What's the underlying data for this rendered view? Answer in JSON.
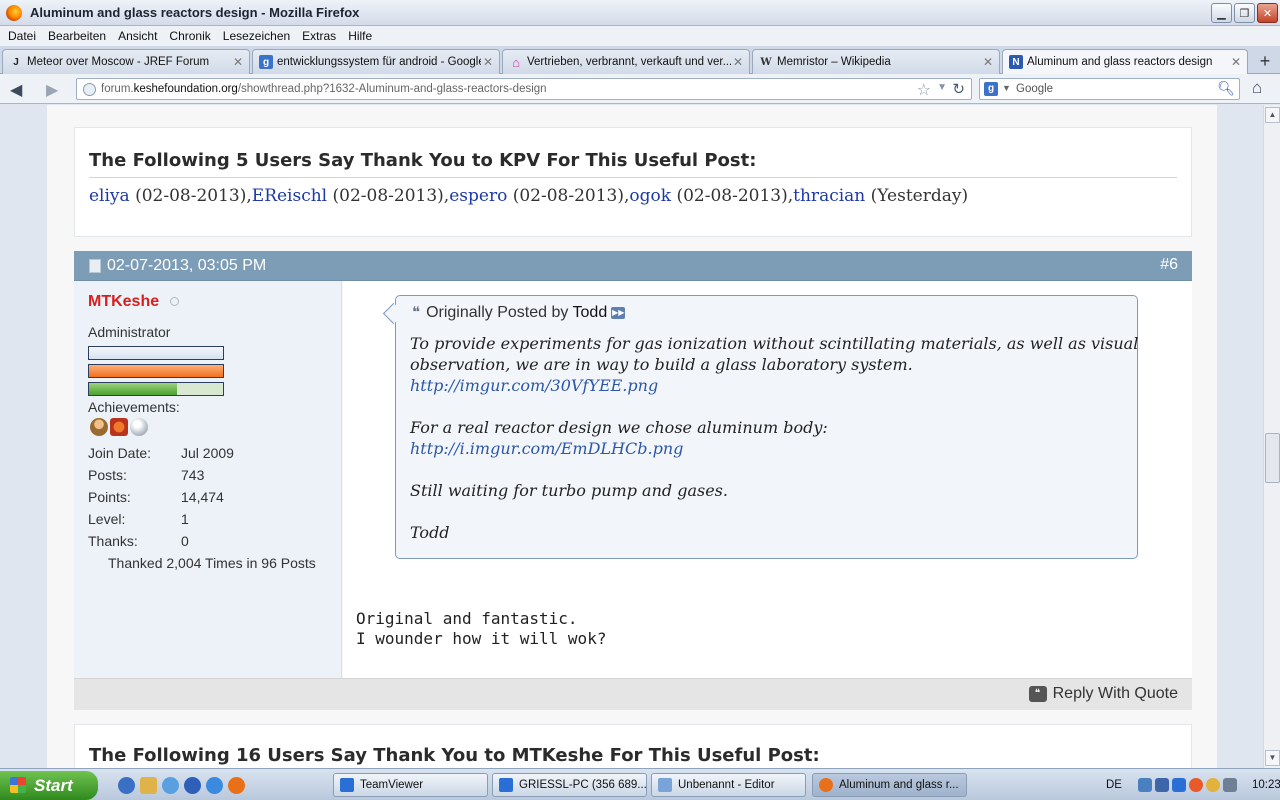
{
  "window": {
    "title": "Aluminum and glass reactors design - Mozilla Firefox"
  },
  "menu": [
    "Datei",
    "Bearbeiten",
    "Ansicht",
    "Chronik",
    "Lesezeichen",
    "Extras",
    "Hilfe"
  ],
  "tabs": [
    {
      "label": "Meteor over Moscow - JREF Forum",
      "icon": "jref-favicon",
      "icon_glyph": "J",
      "icon_color": "#222222"
    },
    {
      "label": "entwicklungssystem für android - Google-...",
      "icon": "google-favicon",
      "icon_glyph": "g",
      "icon_color": "#3a73c9"
    },
    {
      "label": "Vertrieben, verbrannt, verkauft und ver...",
      "icon": "house-favicon",
      "icon_glyph": "⌂",
      "icon_color": "#c93ca3"
    },
    {
      "label": "Memristor – Wikipedia",
      "icon": "wikipedia-favicon",
      "icon_glyph": "W",
      "icon_color": "#333333"
    },
    {
      "label": "Aluminum and glass reactors design",
      "icon": "keshe-favicon",
      "icon_glyph": "N",
      "icon_color": "#2a5bb0"
    }
  ],
  "nav": {
    "url_prefix": "forum.",
    "url_domain": "keshefoundation.org",
    "url_path": "/showthread.php?1632-Aluminum-and-glass-reactors-design",
    "search_engine": "g",
    "search_placeholder": "Google"
  },
  "thanks_top": {
    "title": "The Following 5 Users Say Thank You to KPV For This Useful Post:",
    "entries": [
      {
        "name": "eliya",
        "date": " (02-08-2013),"
      },
      {
        "name": "EReischl",
        "date": " (02-08-2013),"
      },
      {
        "name": "espero",
        "date": " (02-08-2013),"
      },
      {
        "name": "ogok",
        "date": " (02-08-2013),"
      },
      {
        "name": "thracian",
        "date": " (Yesterday)"
      }
    ]
  },
  "post": {
    "date": "02-07-2013, 03:05 PM",
    "number": "#6",
    "user": {
      "name": "MTKeshe",
      "role": "Administrator",
      "achievements_label": "Achievements:",
      "stats": [
        {
          "k": "Join Date:",
          "v": "Jul 2009"
        },
        {
          "k": "Posts:",
          "v": "743"
        },
        {
          "k": "Points:",
          "v": "14,474"
        },
        {
          "k": "Level:",
          "v": "1"
        },
        {
          "k": "Thanks:",
          "v": "0"
        }
      ],
      "thanked": "Thanked 2,004 Times in 96 Posts"
    },
    "quote": {
      "prefix": "Originally Posted by",
      "author": "Todd",
      "lines": [
        "To provide experiments for gas ionization without scintillating materials, as well as visual",
        "observation, we are in way to build a glass laboratory system.",
        "http://imgur.com/30VfYEE.png",
        "For a real reactor design we chose aluminum body:",
        "http://i.imgur.com/EmDLHCb.png",
        "Still waiting for turbo pump and gases.",
        "Todd"
      ]
    },
    "message": [
      "Original and fantastic.",
      "I wounder how it will wok?"
    ],
    "reply_label": "Reply With Quote"
  },
  "thanks_bottom": {
    "title": "The Following 16 Users Say Thank You to MTKeshe For This Useful Post:"
  },
  "taskbar": {
    "start": "Start",
    "items": [
      {
        "label": "TeamViewer",
        "color": "#2a6fd6"
      },
      {
        "label": "GRIESSL-PC (356 689...",
        "color": "#2a6fd6"
      },
      {
        "label": "Unbenannt - Editor",
        "color": "#7aa3d8"
      },
      {
        "label": "Aluminum and glass r...",
        "color": "#e8701a"
      }
    ],
    "lang": "DE",
    "clock": "10:23"
  }
}
